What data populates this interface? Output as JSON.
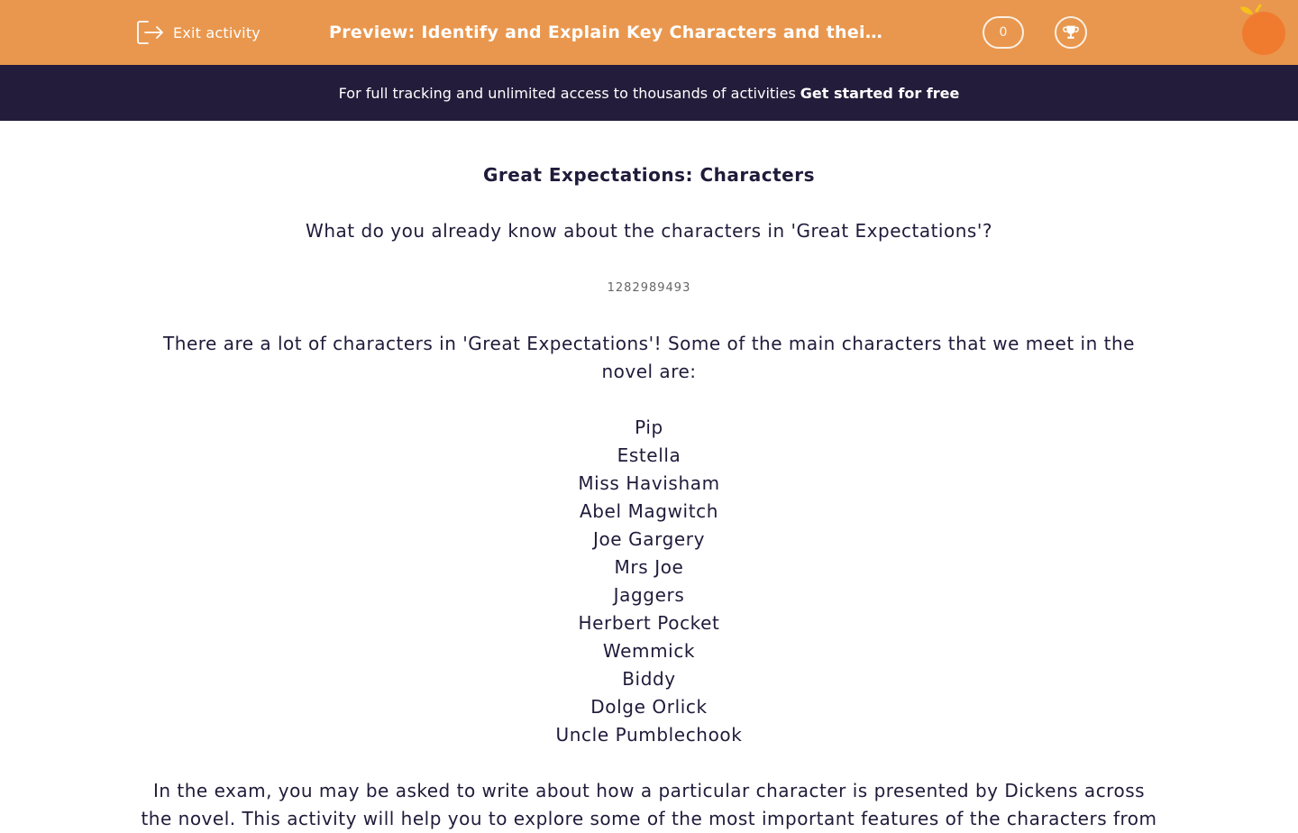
{
  "header": {
    "exit_label": "Exit activity",
    "title": "Preview: Identify and Explain Key Characters and their De…",
    "score": "0",
    "brand_color": "#e9974e"
  },
  "banner": {
    "text": "For full tracking and unlimited access to thousands of activities",
    "cta": "Get started for free",
    "background": "#231c3a"
  },
  "main": {
    "heading": "Great Expectations: Characters",
    "question": "What do you already know about the characters in 'Great Expectations'?",
    "question_id": "1282989493",
    "intro": "There are a lot of characters in 'Great Expectations'! Some of the main characters that we meet in the novel are:",
    "characters": [
      "Pip",
      "Estella",
      "Miss Havisham",
      "Abel Magwitch",
      "Joe Gargery",
      "Mrs Joe",
      "Jaggers",
      "Herbert Pocket",
      "Wemmick",
      "Biddy",
      "Dolge Orlick",
      "Uncle Pumblechook"
    ],
    "exam_text": "In the exam, you may be asked to write about how a particular character is presented by Dickens across the novel. This activity will help you to explore some of the most important features of the characters from"
  },
  "icons": {
    "exit": "exit-door-icon",
    "trophy": "trophy-icon",
    "logo": "orange-logo-icon"
  }
}
